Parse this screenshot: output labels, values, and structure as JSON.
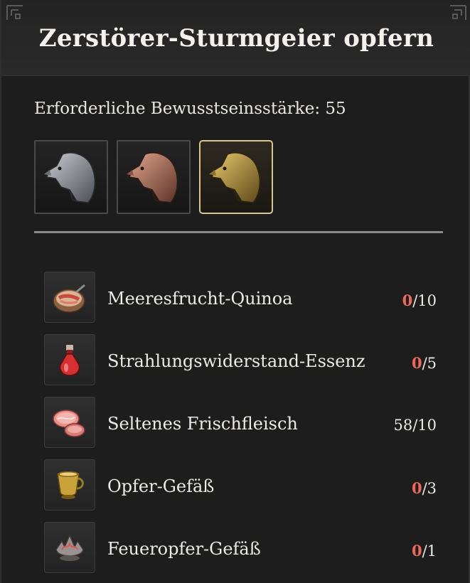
{
  "title": "Zerstörer-Sturmgeier opfern",
  "requirement": {
    "label": "Erforderliche Bewusstseinsstärke: 55"
  },
  "variants": [
    {
      "name": "gray-vulture-variant",
      "color": "#8c9196",
      "selected": false
    },
    {
      "name": "copper-vulture-variant",
      "color": "#a9705c",
      "selected": false
    },
    {
      "name": "gold-vulture-variant",
      "color": "#b9963e",
      "selected": true
    }
  ],
  "materials": [
    {
      "name": "Meeresfrucht-Quinoa",
      "have": "0",
      "need": "/10",
      "icon": "quinoa-bowl-icon"
    },
    {
      "name": "Strahlungswiderstand-Essenz",
      "have": "0",
      "need": "/5",
      "icon": "red-potion-icon"
    },
    {
      "name": "Seltenes Frischfleisch",
      "have": "58",
      "need": "/10",
      "icon": "raw-meat-icon"
    },
    {
      "name": "Opfer-Gefäß",
      "have": "0",
      "need": "/3",
      "icon": "golden-cup-icon"
    },
    {
      "name": "Feueropfer-Gefäß",
      "have": "0",
      "need": "/1",
      "icon": "fire-vessel-icon"
    }
  ],
  "colors": {
    "missing": "#ec6a5a",
    "selected_border": "#d8c690"
  }
}
